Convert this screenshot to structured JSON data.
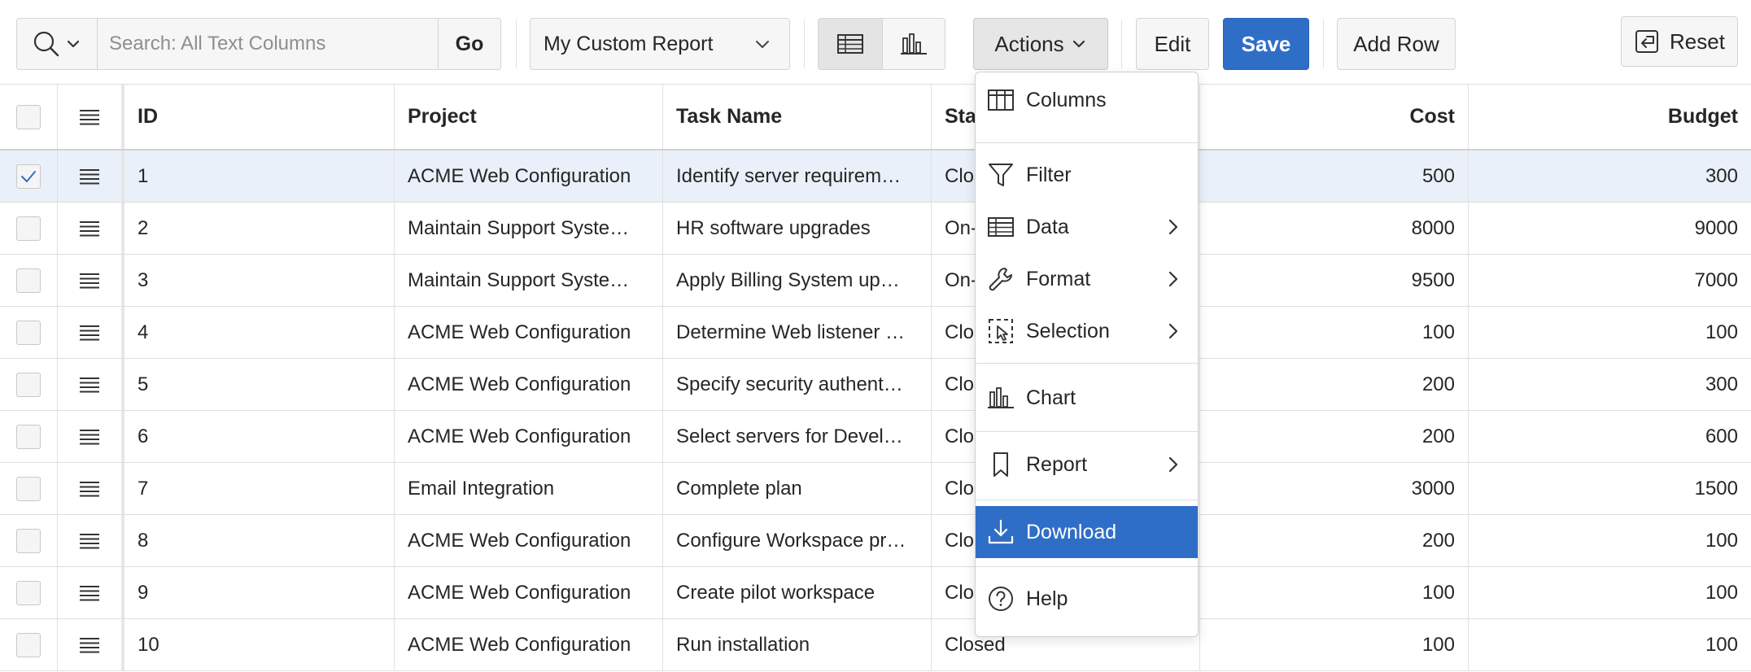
{
  "toolbar": {
    "search_placeholder": "Search: All Text Columns",
    "go_label": "Go",
    "report_name": "My Custom Report",
    "actions_label": "Actions",
    "edit_label": "Edit",
    "save_label": "Save",
    "add_row_label": "Add Row",
    "reset_label": "Reset"
  },
  "grid": {
    "columns": [
      "ID",
      "Project",
      "Task Name",
      "Status",
      "Cost",
      "Budget"
    ],
    "rows": [
      {
        "id": "1",
        "project": "ACME Web Configuration",
        "task": "Identify server requirem…",
        "status": "Closed",
        "cost": "500",
        "budget": "300",
        "checked": true
      },
      {
        "id": "2",
        "project": "Maintain Support Syste…",
        "task": "HR software upgrades",
        "status": "On-Hold",
        "cost": "8000",
        "budget": "9000",
        "checked": false
      },
      {
        "id": "3",
        "project": "Maintain Support Syste…",
        "task": "Apply Billing System up…",
        "status": "On-Hold",
        "cost": "9500",
        "budget": "7000",
        "checked": false
      },
      {
        "id": "4",
        "project": "ACME Web Configuration",
        "task": "Determine Web listener …",
        "status": "Closed",
        "cost": "100",
        "budget": "100",
        "checked": false
      },
      {
        "id": "5",
        "project": "ACME Web Configuration",
        "task": "Specify security authent…",
        "status": "Closed",
        "cost": "200",
        "budget": "300",
        "checked": false
      },
      {
        "id": "6",
        "project": "ACME Web Configuration",
        "task": "Select servers for Devel…",
        "status": "Closed",
        "cost": "200",
        "budget": "600",
        "checked": false
      },
      {
        "id": "7",
        "project": "Email Integration",
        "task": "Complete plan",
        "status": "Closed",
        "cost": "3000",
        "budget": "1500",
        "checked": false
      },
      {
        "id": "8",
        "project": "ACME Web Configuration",
        "task": "Configure Workspace pr…",
        "status": "Closed",
        "cost": "200",
        "budget": "100",
        "checked": false
      },
      {
        "id": "9",
        "project": "ACME Web Configuration",
        "task": "Create pilot workspace",
        "status": "Closed",
        "cost": "100",
        "budget": "100",
        "checked": false
      },
      {
        "id": "10",
        "project": "ACME Web Configuration",
        "task": "Run installation",
        "status": "Closed",
        "cost": "100",
        "budget": "100",
        "checked": false
      }
    ]
  },
  "actions_menu": {
    "items": [
      {
        "label": "Columns",
        "icon": "columns-icon",
        "submenu": false
      },
      {
        "label": "Filter",
        "icon": "filter-icon",
        "submenu": false
      },
      {
        "label": "Data",
        "icon": "table-icon",
        "submenu": true
      },
      {
        "label": "Format",
        "icon": "wrench-icon",
        "submenu": true
      },
      {
        "label": "Selection",
        "icon": "selection-icon",
        "submenu": true
      },
      {
        "label": "Chart",
        "icon": "bar-chart-icon",
        "submenu": false
      },
      {
        "label": "Report",
        "icon": "bookmark-icon",
        "submenu": true
      },
      {
        "label": "Download",
        "icon": "download-icon",
        "submenu": false,
        "active": true
      },
      {
        "label": "Help",
        "icon": "help-icon",
        "submenu": false
      }
    ]
  },
  "colors": {
    "primary": "#2f6ec6",
    "selected_row": "#e9f0fa",
    "border": "#dedede"
  }
}
